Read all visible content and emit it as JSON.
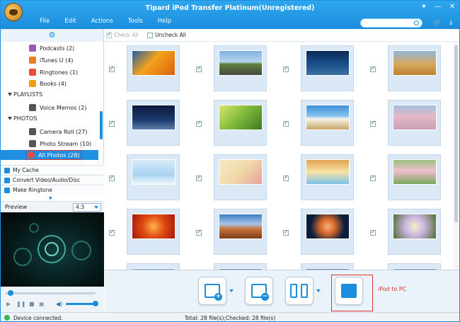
{
  "window": {
    "title": "Tipard iPod Transfer Platinum(Unregistered)",
    "controls": [
      "▾",
      "—",
      "✕"
    ]
  },
  "menu": [
    "File",
    "Edit",
    "Actions",
    "Tools",
    "Help"
  ],
  "search": {
    "placeholder": ""
  },
  "sidebar": {
    "media_items": [
      {
        "label": "Podcasts (2)",
        "color": "#9b59b6"
      },
      {
        "label": "iTunes U (4)",
        "color": "#e67e22"
      },
      {
        "label": "Ringtones (1)",
        "color": "#e74c3c"
      },
      {
        "label": "Books (4)",
        "color": "#f39c12"
      }
    ],
    "playlists_header": "PLAYLISTS",
    "playlist_items": [
      {
        "label": "Voice Memos (2)",
        "color": "#555"
      }
    ],
    "photos_header": "PHOTOS",
    "photo_items": [
      {
        "label": "Camera Roll (27)",
        "color": "#555"
      },
      {
        "label": "Photo Stream (10)",
        "color": "#555"
      },
      {
        "label": "All Photos (28)",
        "color": "#e74c3c",
        "selected": true
      }
    ],
    "tools": [
      "My Cache",
      "Convert Video/Audio/Disc",
      "Make Ringtone"
    ]
  },
  "preview": {
    "label": "Preview",
    "ratio": "4:3"
  },
  "checkbar": {
    "check_all": "Check All",
    "uncheck_all": "Uncheck All"
  },
  "photos": [
    {
      "checked": true,
      "bg": "linear-gradient(135deg,#1e5fa8 0%,#f3a21b 45%,#d9620f 100%)"
    },
    {
      "checked": true,
      "bg": "linear-gradient(#7db3e2 0%,#b7d5ef 45%,#5f7d3a 55%,#464b3f 100%)"
    },
    {
      "checked": true,
      "bg": "linear-gradient(#0a2a55 0%,#1b4f8a 55%,#3d6fa0 100%)"
    },
    {
      "checked": true,
      "bg": "linear-gradient(#8fb7de 0%,#d8a95a 55%,#b9822f 100%)"
    },
    {
      "checked": true,
      "bg": "linear-gradient(#0c1b3c 0%,#1d3a6f 60%,#5d7fa8 100%)"
    },
    {
      "checked": true,
      "bg": "linear-gradient(135deg,#d7e66a 0%,#7fb83a 50%,#3a7a22 100%)"
    },
    {
      "checked": true,
      "bg": "linear-gradient(#3e8fd8 0%,#8ac4ee 45%,#f4f4ea 55%,#c9a86b 100%)"
    },
    {
      "checked": true,
      "bg": "linear-gradient(#a3c1e0 0%,#e3b7c6 45%,#caa0b6 100%)"
    },
    {
      "checked": true,
      "bg": "linear-gradient(#d6ecfa 0%,#a9d3f0 60%,#eaf5fd 100%)"
    },
    {
      "checked": true,
      "bg": "linear-gradient(135deg,#f6e9c9 0%,#f0d9a8 50%,#e8a0a0 100%)"
    },
    {
      "checked": true,
      "bg": "linear-gradient(#e2a352 0%,#f7e2a6 50%,#7bc0e8 100%)"
    },
    {
      "checked": true,
      "bg": "linear-gradient(#9ac17a 0%,#f0bfd0 45%,#7aa85a 100%)"
    },
    {
      "checked": true,
      "bg": "radial-gradient(circle,#ffb24a 0%,#e04b12 45%,#a4180a 100%)"
    },
    {
      "checked": true,
      "bg": "linear-gradient(#3f7dc4 0%,#a6c7e8 40%,#c9733a 60%,#7a3c17 100%)"
    },
    {
      "checked": true,
      "bg": "radial-gradient(circle,#f6b07a 0%,#d96a2d 30%,#0a1e3c 70%)"
    },
    {
      "checked": true,
      "bg": "radial-gradient(circle,#f4f0c8 0%,#c9b4e0 40%,#4d6d2d 100%)"
    },
    {
      "checked": false,
      "bg": "linear-gradient(#7aa0c8,#c8d9ea)"
    },
    {
      "checked": false,
      "bg": "linear-gradient(#6a8db4,#b3c8de)"
    },
    {
      "checked": false,
      "bg": "linear-gradient(#5b7fa6,#a9c0d9)"
    },
    {
      "checked": false,
      "bg": "linear-gradient(#7a96b5,#c5d4e4)"
    }
  ],
  "actions": {
    "ipod_to_pc_label": "iPod to PC"
  },
  "status": {
    "left": "Device connected.",
    "center": "Total: 28 file(s);Checked: 28 file(s)"
  }
}
